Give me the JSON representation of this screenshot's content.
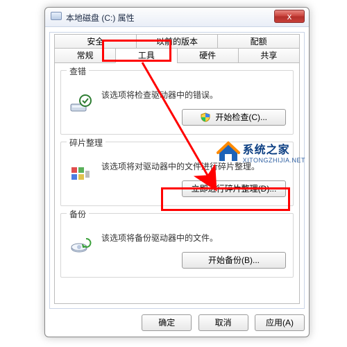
{
  "window": {
    "title": "本地磁盘 (C:) 属性",
    "close_x": "x"
  },
  "tabs": {
    "row1": [
      "安全",
      "以前的版本",
      "配额"
    ],
    "row2": [
      "常规",
      "工具",
      "硬件",
      "共享"
    ],
    "active": "工具"
  },
  "groups": {
    "check": {
      "legend": "查错",
      "desc": "该选项将检查驱动器中的错误。",
      "button": "开始检查(C)..."
    },
    "defrag": {
      "legend": "碎片整理",
      "desc": "该选项将对驱动器中的文件进行碎片整理。",
      "button": "立即进行碎片整理(D)..."
    },
    "backup": {
      "legend": "备份",
      "desc": "该选项将备份驱动器中的文件。",
      "button": "开始备份(B)..."
    }
  },
  "dialog_buttons": {
    "ok": "确定",
    "cancel": "取消",
    "apply": "应用(A)"
  },
  "watermark": {
    "cn": "系统之家",
    "en": "XITONGZHIJIA.NET"
  }
}
